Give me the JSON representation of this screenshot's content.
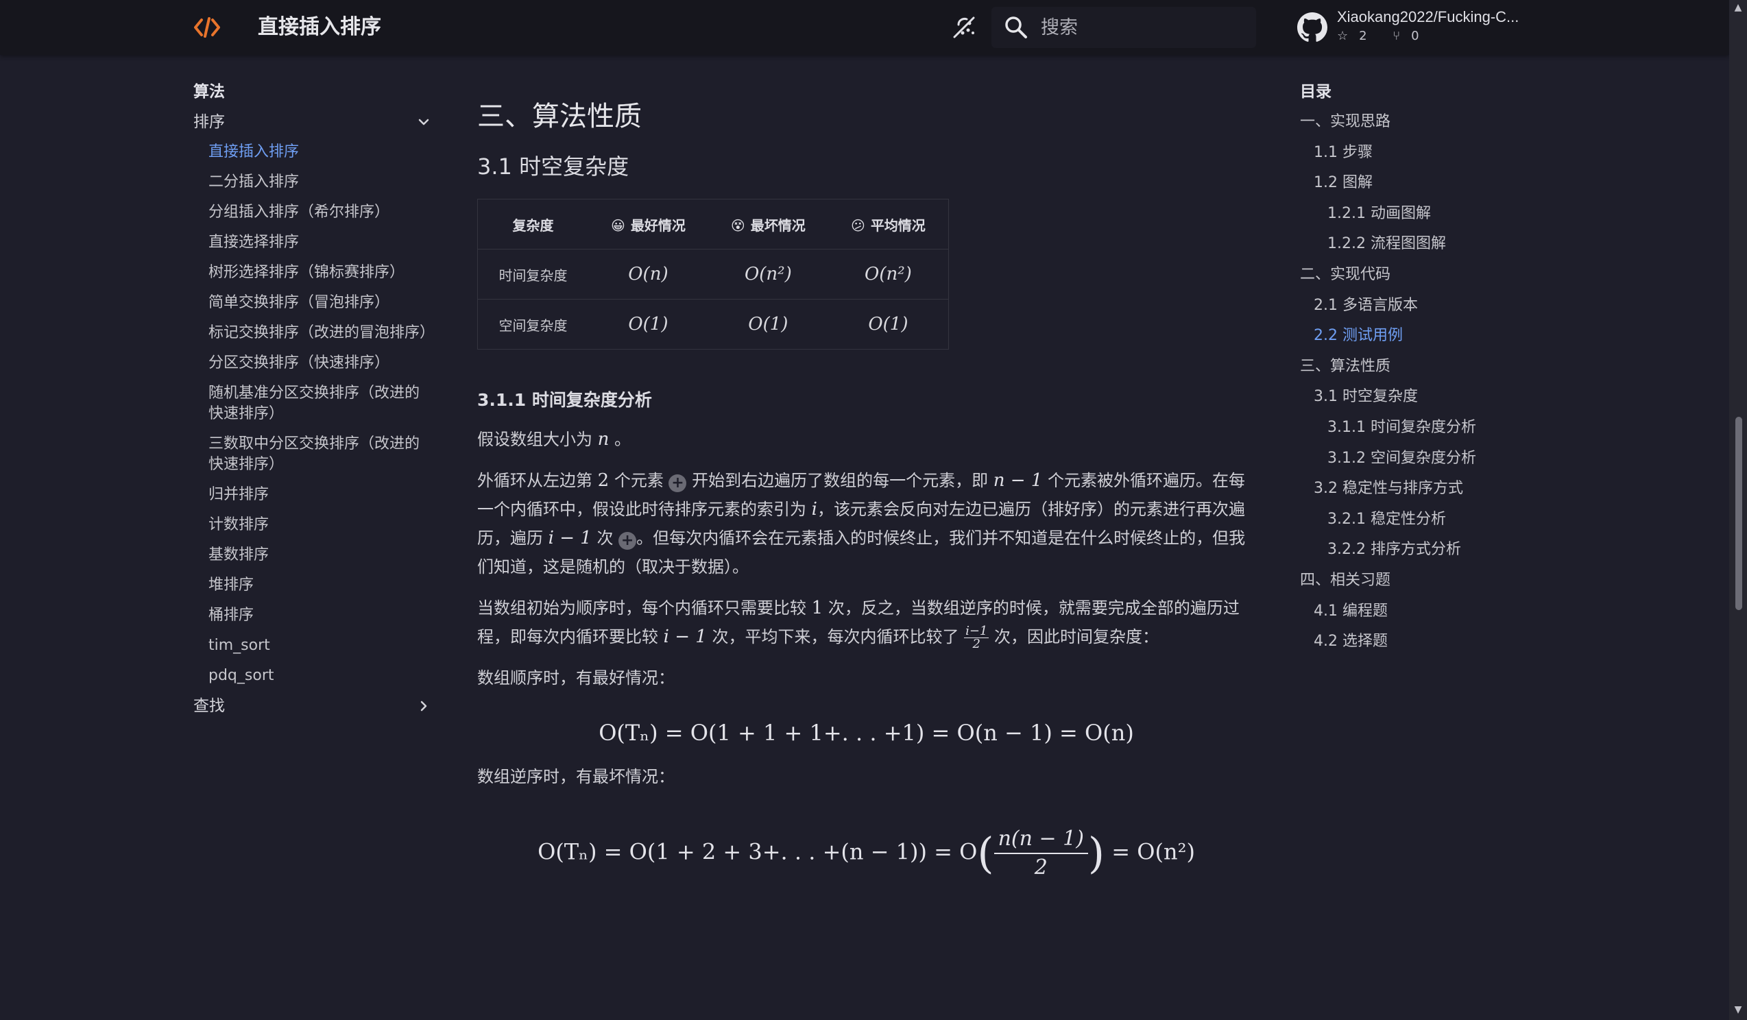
{
  "header": {
    "title": "直接插入排序",
    "search_placeholder": "搜索",
    "repo": {
      "name": "Xiaokang2022/Fucking-C...",
      "stars": "2",
      "forks": "0"
    }
  },
  "sidebar": {
    "heading": "算法",
    "group_sort": "排序",
    "items": [
      "直接插入排序",
      "二分插入排序",
      "分组插入排序（希尔排序）",
      "直接选择排序",
      "树形选择排序（锦标赛排序）",
      "简单交换排序（冒泡排序）",
      "标记交换排序（改进的冒泡排序）",
      "分区交换排序（快速排序）",
      "随机基准分区交换排序（改进的快速排序）",
      "三数取中分区交换排序（改进的快速排序）",
      "归并排序",
      "计数排序",
      "基数排序",
      "堆排序",
      "桶排序",
      "tim_sort",
      "pdq_sort"
    ],
    "group_search": "查找"
  },
  "main": {
    "section_title": "三、算法性质",
    "sub_title": "3.1 时空复杂度",
    "table": {
      "headers": [
        "复杂度",
        "最好情况",
        "最坏情况",
        "平均情况"
      ],
      "emojis": [
        "😀",
        "😵",
        "😕"
      ],
      "rows": [
        {
          "label": "时间复杂度",
          "best": "O(n)",
          "worst": "O(n²)",
          "avg": "O(n²)"
        },
        {
          "label": "空间复杂度",
          "best": "O(1)",
          "worst": "O(1)",
          "avg": "O(1)"
        }
      ]
    },
    "subsub_title": "3.1.1 时间复杂度分析",
    "p1_a": "假设数组大小为",
    "p1_n": "n",
    "p1_b": "。",
    "p2_a": "外循环从左边第",
    "p2_two": "2",
    "p2_b": "个元素",
    "p2_c": "开始到右边遍历了数组的每一个元素，即",
    "p2_nm1": "n − 1",
    "p2_d": "个元素被外循环遍历。在每一个内循环中，假设此时待排序元素的索引为",
    "p2_i": "i",
    "p2_e": "，该元素会反向对左边已遍历（排好序）的元素进行再次遍历，遍历",
    "p2_im1": "i − 1",
    "p2_f": "次",
    "p2_g": "。但每次内循环会在元素插入的时候终止，我们并不知道是在什么时候终止的，但我们知道，这是随机的（取决于数据）。",
    "p3_a": "当数组初始为顺序时，每个内循环只需要比较",
    "p3_one": "1",
    "p3_b": "次，反之，当数组逆序的时候，就需要完成全部的遍历过程，即每次内循环要比较",
    "p3_im1": "i − 1",
    "p3_c": "次，平均下来，每次内循环比较了",
    "p3_frac_num": "i−1",
    "p3_frac_den": "2",
    "p3_d": "次，因此时间复杂度：",
    "p4": "数组顺序时，有最好情况：",
    "formula1": "O(Tₙ) = O(1 + 1 + 1+. . . +1) = O(n − 1) = O(n)",
    "p5": "数组逆序时，有最坏情况：",
    "formula2_a": "O(Tₙ) = O(1 + 2 + 3+. . . +(n − 1)) = O",
    "formula2_num": "n(n − 1)",
    "formula2_den": "2",
    "formula2_b": "= O(n²)"
  },
  "toc": {
    "title": "目录",
    "items": [
      {
        "label": "一、实现思路",
        "level": 1
      },
      {
        "label": "1.1 步骤",
        "level": 2
      },
      {
        "label": "1.2 图解",
        "level": 2
      },
      {
        "label": "1.2.1 动画图解",
        "level": 3
      },
      {
        "label": "1.2.2 流程图图解",
        "level": 3
      },
      {
        "label": "二、实现代码",
        "level": 1
      },
      {
        "label": "2.1 多语言版本",
        "level": 2
      },
      {
        "label": "2.2 测试用例",
        "level": 2
      },
      {
        "label": "三、算法性质",
        "level": 1
      },
      {
        "label": "3.1 时空复杂度",
        "level": 2
      },
      {
        "label": "3.1.1 时间复杂度分析",
        "level": 3
      },
      {
        "label": "3.1.2 空间复杂度分析",
        "level": 3
      },
      {
        "label": "3.2 稳定性与排序方式",
        "level": 2
      },
      {
        "label": "3.2.1 稳定性分析",
        "level": 3
      },
      {
        "label": "3.2.2 排序方式分析",
        "level": 3
      },
      {
        "label": "四、相关习题",
        "level": 1
      },
      {
        "label": "4.1 编程题",
        "level": 2
      },
      {
        "label": "4.2 选择题",
        "level": 2
      }
    ]
  },
  "colors": {
    "accent": "#6f9ef2",
    "logo": "#e8742c",
    "background": "#1e1e2a",
    "header": "#16161d"
  }
}
